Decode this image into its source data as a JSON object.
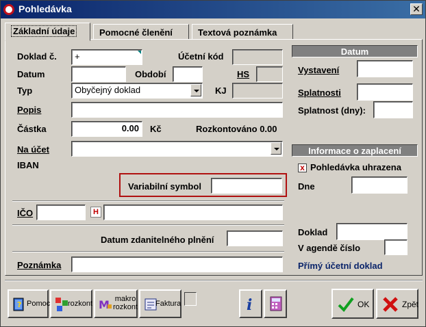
{
  "window": {
    "title": "Pohledávka"
  },
  "tabs": [
    {
      "label": "Základní údaje",
      "active": true
    },
    {
      "label": "Pomocné členění",
      "active": false
    },
    {
      "label": "Textová poznámka",
      "active": false
    }
  ],
  "form": {
    "doklad_label": "Doklad č.",
    "doklad_value": "+",
    "ucetni_kod_label": "Účetní kód",
    "datum_label": "Datum",
    "obdobi_label": "Období",
    "hs_label": "HS",
    "typ_label": "Typ",
    "typ_value": "Obyčejný doklad",
    "kj_label": "KJ",
    "popis_label": "Popis",
    "castka_label": "Částka",
    "castka_value": "0.00",
    "currency": "Kč",
    "rozkontovano_label": "Rozkontováno",
    "rozkontovano_value": "0.00",
    "na_ucet_label": "Na účet",
    "iban_label": "IBAN",
    "variabilni_label": "Variabilní symbol",
    "ico_label": "IČO",
    "h_button": "H",
    "datum_zdan_label": "Datum zdanitelného plnění",
    "poznamka_label": "Poznámka"
  },
  "datum_section": {
    "header": "Datum",
    "vystaveni_label": "Vystavení",
    "splatnosti_label": "Splatnosti",
    "splatnost_dny_label": "Splatnost (dny):"
  },
  "payment_section": {
    "header": "Informace o zaplacení",
    "uhrazena_label": "Pohledávka uhrazena",
    "uhrazena_mark": "x",
    "dne_label": "Dne",
    "doklad_label": "Doklad",
    "agenda_label": "V agendě číslo",
    "primy_link": "Přímý účetní doklad"
  },
  "toolbar": {
    "pomoc": "Pomoc",
    "rozkont": "rozkont",
    "makro_line1": "makro",
    "makro_line2": "rozkont",
    "faktura": "Faktura",
    "ok": "OK",
    "zpet": "Zpět"
  },
  "colors": {
    "title_bar": "#0a246a",
    "highlight_box": "#b01010",
    "link": "#0a246a"
  }
}
